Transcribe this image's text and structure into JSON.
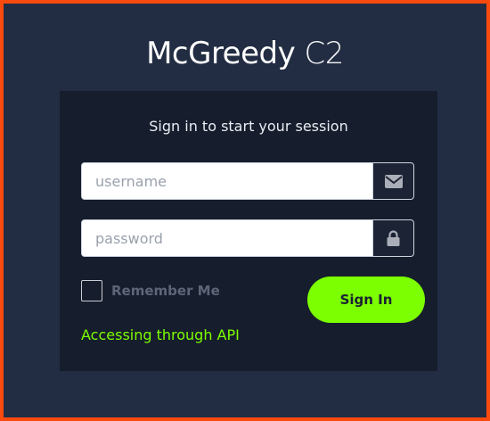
{
  "brand": {
    "name": "McGreedy",
    "suffix": "C2"
  },
  "login": {
    "message": "Sign in to start your session",
    "username_placeholder": "username",
    "password_placeholder": "password",
    "remember_label": "Remember Me",
    "submit_label": "Sign In",
    "api_link": "Accessing through API"
  },
  "colors": {
    "frame": "#fa4a0d",
    "background": "#222d43",
    "card": "#161d2c",
    "accent": "#7cff00"
  },
  "icons": {
    "username": "envelope-icon",
    "password": "lock-icon"
  }
}
